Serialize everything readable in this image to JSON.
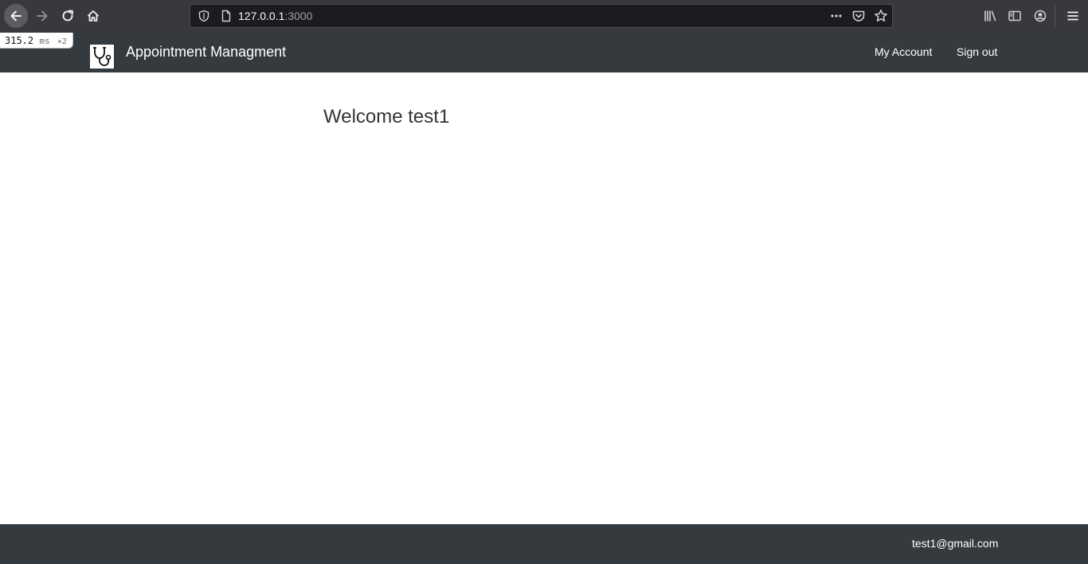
{
  "browser": {
    "url_host": "127.0.0.1",
    "url_port": ":3000",
    "icons": {
      "back": "arrow-left-icon",
      "forward": "arrow-right-icon",
      "reload": "reload-icon",
      "home": "home-icon",
      "tracking": "shield-icon",
      "page": "page-icon",
      "page_actions": "more-dots-icon",
      "pocket": "pocket-icon",
      "bookmark": "star-icon",
      "library": "library-icon",
      "sidebar": "sidebar-icon",
      "account": "account-icon",
      "menu": "hamburger-menu-icon"
    }
  },
  "timing": {
    "value": "315.2",
    "unit": "ms",
    "count": "×2"
  },
  "navbar": {
    "brand_logo": "stethoscope-icon",
    "brand_name": "Appointment Managment",
    "links": {
      "my_account": "My Account",
      "sign_out": "Sign out"
    }
  },
  "main": {
    "welcome": "Welcome test1"
  },
  "footer": {
    "email": "test1@gmail.com"
  },
  "colors": {
    "navbar_bg": "#343a3d",
    "browser_bg": "#38383d",
    "text_dark": "#333333"
  }
}
